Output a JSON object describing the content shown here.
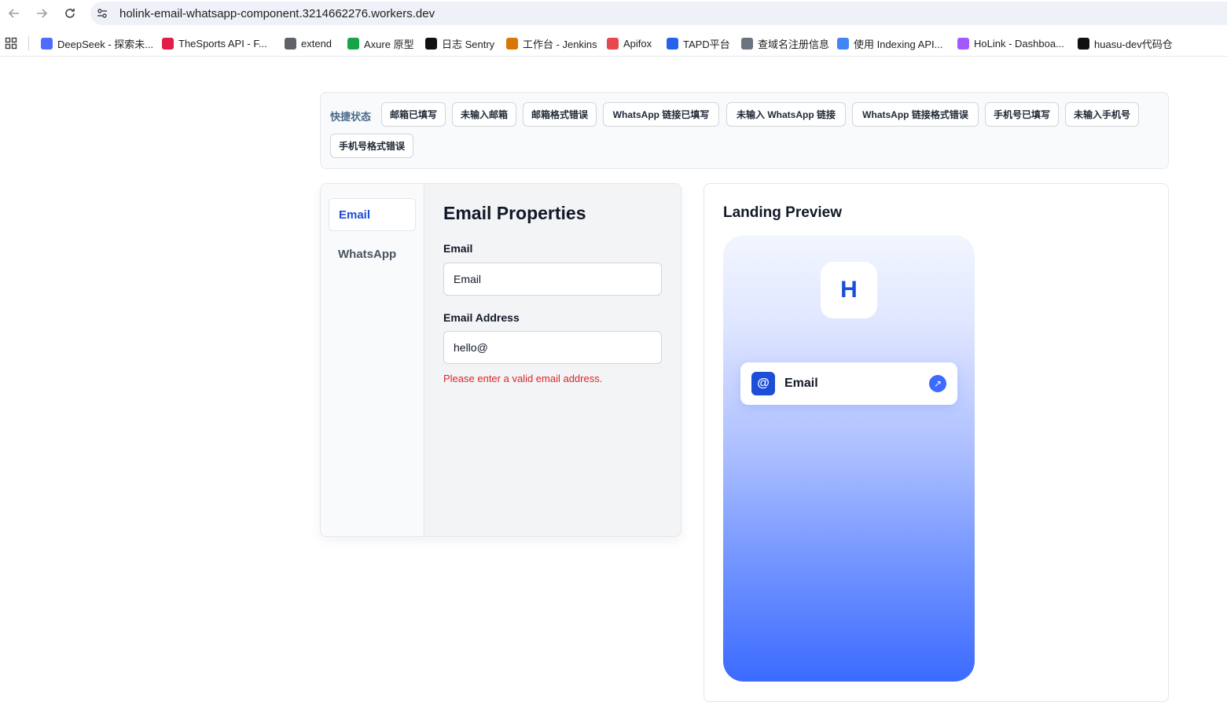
{
  "browser": {
    "url": "holink-email-whatsapp-component.3214662276.workers.dev",
    "bookmarks": [
      {
        "label": "DeepSeek - 探索未...",
        "icon": "deepseek-icon",
        "color": "#4d6bfe"
      },
      {
        "label": "TheSports API - F...",
        "icon": "thesports-icon",
        "color": "#e11d48"
      },
      {
        "label": "extend",
        "icon": "folder-icon",
        "color": "#5f6368"
      },
      {
        "label": "Axure 原型",
        "icon": "axure-icon",
        "color": "#16a34a"
      },
      {
        "label": "日志 Sentry",
        "icon": "sentry-icon",
        "color": "#111111"
      },
      {
        "label": "工作台 - Jenkins",
        "icon": "jenkins-icon",
        "color": "#d97706"
      },
      {
        "label": "Apifox",
        "icon": "apifox-icon",
        "color": "#e5484d"
      },
      {
        "label": "TAPD平台",
        "icon": "tapd-icon",
        "color": "#2563eb"
      },
      {
        "label": "查域名注册信息",
        "icon": "domain-icon",
        "color": "#6b7280"
      },
      {
        "label": "使用 Indexing API...",
        "icon": "google-icon",
        "color": "#4285f4"
      },
      {
        "label": "HoLink - Dashboa...",
        "icon": "figma-icon",
        "color": "#a259ff"
      },
      {
        "label": "huasu-dev代码仓",
        "icon": "github-icon",
        "color": "#111111"
      }
    ]
  },
  "quick_status": {
    "label": "快捷状态",
    "buttons": [
      "邮箱已填写",
      "未输入邮箱",
      "邮箱格式错误",
      "WhatsApp 链接已填写",
      "未输入 WhatsApp 链接",
      "WhatsApp 链接格式错误",
      "手机号已填写",
      "未输入手机号",
      "手机号格式错误"
    ]
  },
  "properties": {
    "tabs": [
      {
        "label": "Email",
        "active": true
      },
      {
        "label": "WhatsApp",
        "active": false
      }
    ],
    "title": "Email Properties",
    "fields": {
      "email_label": "Email",
      "email_value": "Email",
      "address_label": "Email Address",
      "address_value": "hello@",
      "address_error": "Please enter a valid email address."
    }
  },
  "preview": {
    "title": "Landing Preview",
    "avatar_letter": "H",
    "link": {
      "icon_text": "@",
      "label": "Email",
      "arrow": "↗"
    },
    "colors": {
      "accent": "#1d4ed8",
      "gradient_end": "#3b6bff"
    }
  }
}
